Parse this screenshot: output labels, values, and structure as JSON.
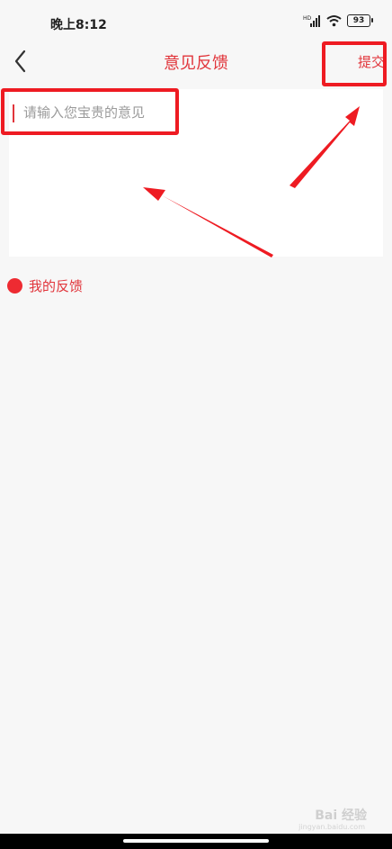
{
  "status_bar": {
    "time": "晚上8:12",
    "battery": "93",
    "icons": [
      "hd-signal-icon",
      "wifi-icon",
      "battery-icon"
    ]
  },
  "header": {
    "title": "意见反馈",
    "back_icon": "chevron-left-icon",
    "submit_label": "提交"
  },
  "feedback_input": {
    "placeholder": "请输入您宝贵的意见",
    "value": ""
  },
  "my_feedback": {
    "label": "我的反馈"
  },
  "watermark": {
    "text": "Bai 经验",
    "sub": "jingyan.baidu.com"
  },
  "colors": {
    "accent": "#e1353b",
    "annotation": "#ee1b22",
    "background": "#f7f7f7"
  }
}
